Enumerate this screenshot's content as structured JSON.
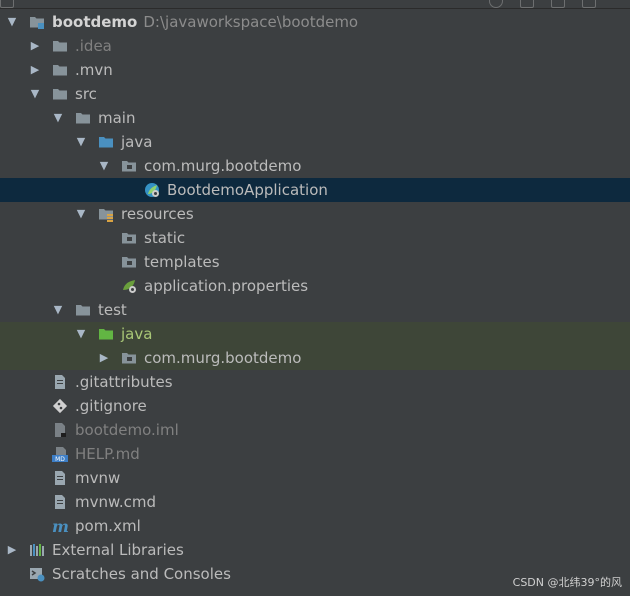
{
  "tree": [
    {
      "id": "bootdemo",
      "label": "bootdemo",
      "path": "D:\\javaworkspace\\bootdemo",
      "level": 0,
      "arrow": "down",
      "icon": "module-folder-icon",
      "style": "bold"
    },
    {
      "id": "idea",
      "label": ".idea",
      "level": 1,
      "arrow": "right",
      "icon": "folder-icon",
      "style": "muted"
    },
    {
      "id": "mvn",
      "label": ".mvn",
      "level": 1,
      "arrow": "right",
      "icon": "folder-icon",
      "style": "normal"
    },
    {
      "id": "src",
      "label": "src",
      "level": 1,
      "arrow": "down",
      "icon": "folder-icon",
      "style": "normal"
    },
    {
      "id": "main",
      "label": "main",
      "level": 2,
      "arrow": "down",
      "icon": "folder-icon",
      "style": "normal"
    },
    {
      "id": "java-main",
      "label": "java",
      "level": 3,
      "arrow": "down",
      "icon": "source-folder-icon",
      "style": "normal"
    },
    {
      "id": "package-main",
      "label": "com.murg.bootdemo",
      "level": 4,
      "arrow": "down",
      "icon": "package-icon",
      "style": "normal"
    },
    {
      "id": "app-class",
      "label": "BootdemoApplication",
      "level": 5,
      "arrow": "none",
      "icon": "spring-class-icon",
      "style": "normal",
      "selected": true
    },
    {
      "id": "resources",
      "label": "resources",
      "level": 3,
      "arrow": "down",
      "icon": "resources-folder-icon",
      "style": "normal"
    },
    {
      "id": "static",
      "label": "static",
      "level": 4,
      "arrow": "none",
      "icon": "package-icon",
      "style": "normal"
    },
    {
      "id": "templates",
      "label": "templates",
      "level": 4,
      "arrow": "none",
      "icon": "package-icon",
      "style": "normal"
    },
    {
      "id": "app-props",
      "label": "application.properties",
      "level": 4,
      "arrow": "none",
      "icon": "spring-config-icon",
      "style": "normal"
    },
    {
      "id": "test",
      "label": "test",
      "level": 2,
      "arrow": "down",
      "icon": "folder-icon",
      "style": "normal"
    },
    {
      "id": "java-test",
      "label": "java",
      "level": 3,
      "arrow": "down",
      "icon": "test-folder-icon",
      "style": "green",
      "highlight": true
    },
    {
      "id": "package-test",
      "label": "com.murg.bootdemo",
      "level": 4,
      "arrow": "right",
      "icon": "package-icon",
      "style": "normal",
      "highlight": true
    },
    {
      "id": "gitattributes",
      "label": ".gitattributes",
      "level": 1,
      "arrow": "none",
      "icon": "text-file-icon",
      "style": "normal"
    },
    {
      "id": "gitignore",
      "label": ".gitignore",
      "level": 1,
      "arrow": "none",
      "icon": "git-icon",
      "style": "normal"
    },
    {
      "id": "iml",
      "label": "bootdemo.iml",
      "level": 1,
      "arrow": "none",
      "icon": "iml-file-icon",
      "style": "muted"
    },
    {
      "id": "help",
      "label": "HELP.md",
      "level": 1,
      "arrow": "none",
      "icon": "markdown-icon",
      "style": "muted"
    },
    {
      "id": "mvnw",
      "label": "mvnw",
      "level": 1,
      "arrow": "none",
      "icon": "text-file-icon",
      "style": "normal"
    },
    {
      "id": "mvnwcmd",
      "label": "mvnw.cmd",
      "level": 1,
      "arrow": "none",
      "icon": "text-file-icon",
      "style": "normal"
    },
    {
      "id": "pom",
      "label": "pom.xml",
      "level": 1,
      "arrow": "none",
      "icon": "maven-icon",
      "style": "normal"
    },
    {
      "id": "ext-libs",
      "label": "External Libraries",
      "level": 0,
      "arrow": "right",
      "icon": "libraries-icon",
      "style": "normal"
    },
    {
      "id": "scratches",
      "label": "Scratches and Consoles",
      "level": 0,
      "arrow": "none",
      "icon": "scratches-icon",
      "style": "normal"
    }
  ],
  "watermark": "CSDN @北纬39°的风",
  "colors": {
    "background": "#3c3f41",
    "selected": "#0d293e",
    "test_highlight": "#3e4638",
    "folder": "#87939a",
    "source_folder": "#4a90c0",
    "test_folder": "#62b543",
    "spring": "#6a9f3c"
  }
}
